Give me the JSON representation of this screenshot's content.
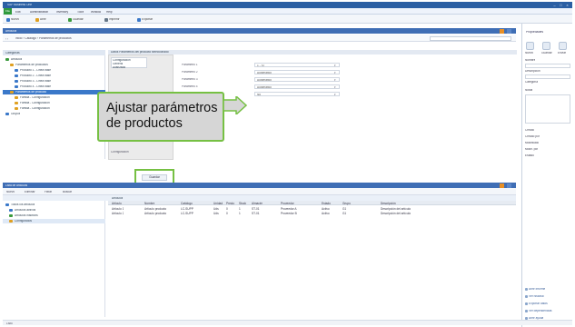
{
  "window": {
    "title": "SAP Business One",
    "controls": [
      "–",
      "□",
      "×"
    ]
  },
  "menubar": {
    "file_label": "File",
    "items": [
      "Edit",
      "Administration",
      "Inventory",
      "Tools",
      "Window",
      "Help"
    ]
  },
  "toolbar": {
    "buttons": [
      {
        "label": "Nuevo",
        "color": "#3a78c9"
      },
      {
        "label": "Abrir",
        "color": "#e0a020"
      },
      {
        "label": "Guardar",
        "color": "#3a9a3c"
      },
      {
        "label": "Imprimir",
        "color": "#667788"
      },
      {
        "label": "Exportar",
        "color": "#3a78c9"
      }
    ]
  },
  "section": {
    "title": "Artículos"
  },
  "addressbar": {
    "path": "Inicio  ›  Catálogo  ›  Parámetros de productos"
  },
  "tree": {
    "header": "Categorías",
    "items": [
      {
        "label": "Artículos",
        "depth": 0,
        "color": "#3a9a3c"
      },
      {
        "label": "Parámetros de productos",
        "depth": 1,
        "color": "#e0a020"
      },
      {
        "label": "Producto 1 - Línea base",
        "depth": 2,
        "color": "#3a78c9"
      },
      {
        "label": "Producto 2 - Línea base",
        "depth": 2,
        "color": "#3a78c9"
      },
      {
        "label": "Producto 3 - Línea base",
        "depth": 2,
        "color": "#3a78c9"
      },
      {
        "label": "Producto 4 - Línea base",
        "depth": 2,
        "color": "#3a78c9"
      },
      {
        "label": "Parámetros de producto",
        "depth": 1,
        "color": "#e0a020",
        "selected": true
      },
      {
        "label": "Familia - Configuración",
        "depth": 2,
        "color": "#e0a020"
      },
      {
        "label": "Familia - Configuración",
        "depth": 2,
        "color": "#e0a020"
      },
      {
        "label": "Familia - Configuración",
        "depth": 2,
        "color": "#e0a020"
      },
      {
        "label": "Grupos",
        "depth": 0,
        "color": "#3a78c9"
      }
    ]
  },
  "form": {
    "header": "Datos   Parámetros del producto seleccionado",
    "subtree_items": [
      "Configuración",
      "General",
      "Avanzado"
    ],
    "fields": [
      {
        "label": "Parámetro 1",
        "value": "1 - Sí"
      },
      {
        "label": "Parámetro 2",
        "value": "Automático"
      },
      {
        "label": "Parámetro 3",
        "value": "Automático"
      },
      {
        "label": "Parámetro 4",
        "value": "Automático"
      },
      {
        "label": "Parámetro 5",
        "value": "No"
      }
    ],
    "footer_label": "Configuración"
  },
  "callout": {
    "text": "Ajustar parámetros de productos"
  },
  "highlighted_button": {
    "label": "Guardar"
  },
  "bottom": {
    "title": "Lista de artículos",
    "toolbar_items": [
      "Nuevo",
      "Eliminar",
      "Filtrar",
      "Buscar"
    ],
    "tab_label": "Artículos",
    "tree_items": [
      {
        "label": "Todos los artículos",
        "color": "#3a78c9"
      },
      {
        "label": "Artículos activos",
        "color": "#3a78c9"
      },
      {
        "label": "Artículos inactivos",
        "color": "#3a9a3c"
      },
      {
        "label": "Configurados",
        "color": "#e0a020"
      }
    ],
    "columns": [
      "Artículo",
      "Nombre",
      "Catálogo",
      "Unidad",
      "Precio",
      "Stock",
      "Almacén",
      "Proveedor",
      "Estado",
      "Grupo",
      "Descripción"
    ],
    "rows": [
      [
        "Artículo 1",
        "Artículo producto",
        "LC-SUPP",
        "Uds",
        "0",
        "1",
        "ST-01",
        "Proveedor A",
        "Activo",
        "G1",
        "Descripción del artículo"
      ],
      [
        "Artículo 2",
        "Artículo producto",
        "LC-SUPP",
        "Uds",
        "0",
        "1",
        "ST-01",
        "Proveedor B",
        "Activo",
        "G1",
        "Descripción del artículo"
      ]
    ]
  },
  "rightpane": {
    "title": "Propiedades",
    "icons": [
      "Nuevo",
      "Guardar",
      "Enviar"
    ],
    "labels": [
      "Nombre",
      "Descripción",
      "Categoría",
      "Notas"
    ],
    "lower_labels": [
      "Creado",
      "Creado por",
      "Modificado",
      "Modif. por",
      "Estado"
    ],
    "links": [
      "Abrir informe",
      "Ver historial",
      "Exportar datos",
      "Ver dependencias",
      "Abrir ayuda"
    ]
  },
  "statusbar": {
    "text": "Listo"
  }
}
